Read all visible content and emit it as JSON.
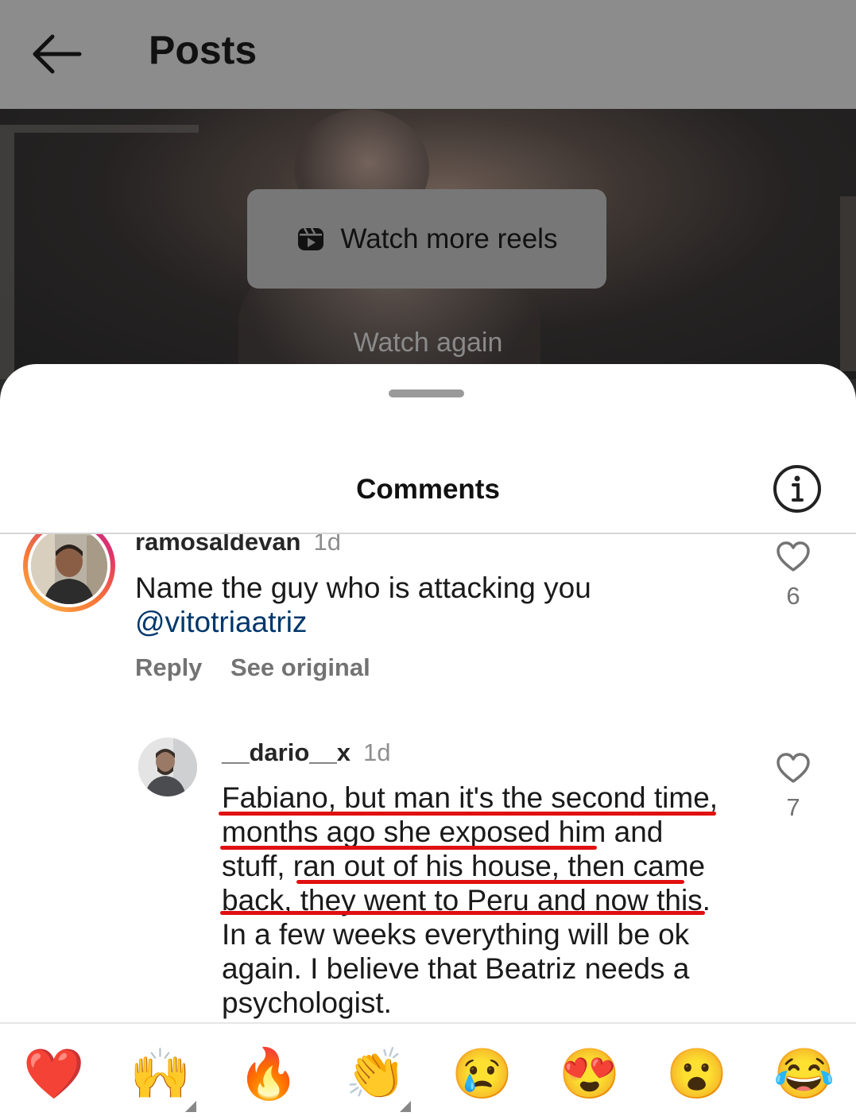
{
  "header": {
    "title": "Posts",
    "back_icon": "arrow-left-icon"
  },
  "video": {
    "watch_more_label": "Watch more reels",
    "watch_again_label": "Watch again"
  },
  "sheet": {
    "title": "Comments",
    "info_icon": "info-icon"
  },
  "comments": [
    {
      "username": "ramosaldevan",
      "time": "1d",
      "text": "Name the guy who is attacking you",
      "mention": "@vitotriaatriz",
      "reply_label": "Reply",
      "see_original_label": "See original",
      "likes": "6"
    },
    {
      "username": "__dario__x",
      "time": "1d",
      "lines": [
        "Fabiano, but man it's the second time,",
        "months ago she exposed him and",
        "stuff, ran out of his house, then came",
        "back, they went to Peru and now this.",
        "In a few weeks everything will be ok",
        "again. I believe that Beatriz needs a",
        "psychologist."
      ],
      "likes": "7"
    }
  ],
  "emoji_bar": [
    "❤️",
    "🙌",
    "🔥",
    "👏",
    "😢",
    "😍",
    "😮",
    "😂"
  ],
  "colors": {
    "underline": "#e01010",
    "mention": "#00376b",
    "header_bg": "#8c8c8c",
    "story_ring_start": "#f9a825",
    "story_ring_end": "#c13584"
  }
}
